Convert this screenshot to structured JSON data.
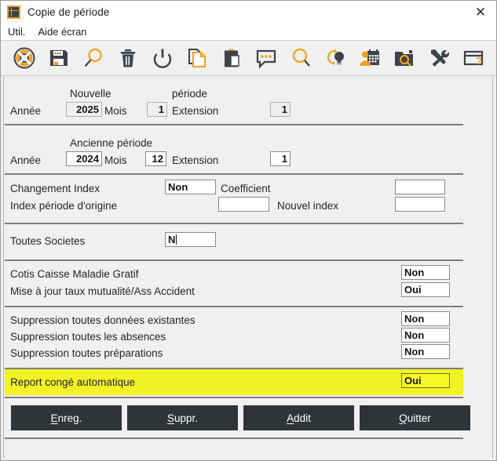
{
  "window": {
    "title": "Copie de période",
    "icon": "app-window-icon",
    "close_label": "✕"
  },
  "menubar": {
    "items": [
      {
        "label": "Util."
      },
      {
        "label": "Aide écran"
      }
    ]
  },
  "toolbar": {
    "buttons": [
      {
        "name": "lifebuoy-icon",
        "title": "Nouveau"
      },
      {
        "name": "save-floppy-icon",
        "title": "Enregistrer"
      },
      {
        "name": "magnifier-plus-icon",
        "title": "Rechercher"
      },
      {
        "name": "trash-icon",
        "title": "Supprimer"
      },
      {
        "name": "power-icon",
        "title": "Quitter"
      },
      {
        "name": "copy-page-icon",
        "title": "Copier"
      },
      {
        "name": "clipboard-paste-icon",
        "title": "Coller"
      },
      {
        "name": "comment-bubble-icon",
        "title": "Commentaire"
      },
      {
        "name": "search-icon",
        "title": "Recherche"
      },
      {
        "name": "refresh-bulb-icon",
        "title": "Astuce"
      },
      {
        "name": "person-calendar-icon",
        "title": "Planning"
      },
      {
        "name": "folder-search-icon",
        "title": "Consulter"
      },
      {
        "name": "tools-icon",
        "title": "Outils"
      },
      {
        "name": "window-help-icon",
        "title": "Aide"
      }
    ]
  },
  "form": {
    "new_period": {
      "header_left": "Nouvelle",
      "header_right": "période",
      "annee_label": "Année",
      "annee_value": "2025",
      "mois_label": "Mois",
      "mois_value": "1",
      "extension_label": "Extension",
      "extension_value": "1"
    },
    "old_period": {
      "header": "Ancienne période",
      "annee_label": "Année",
      "annee_value": "2024",
      "mois_label": "Mois",
      "mois_value": "12",
      "extension_label": "Extension",
      "extension_value": "1"
    },
    "index_group": {
      "changement_index_label": "Changement Index",
      "changement_index_value": "Non",
      "coefficient_label": "Coefficient",
      "coefficient_value": "",
      "index_origine_label": "Index période d'origine",
      "index_origine_value": "",
      "nouvel_index_label": "Nouvel index",
      "nouvel_index_value": ""
    },
    "societes_group": {
      "toutes_societes_label": "Toutes Societes",
      "toutes_societes_value": "N"
    },
    "cotis_group": {
      "rows": [
        {
          "label": "Cotis Caisse Maladie Gratif",
          "value": "Non"
        },
        {
          "label": "Mise à jour taux mutualité/Ass Accident",
          "value": "Oui"
        }
      ]
    },
    "suppression_group": {
      "rows": [
        {
          "label": "Suppression toutes données existantes",
          "value": "Non"
        },
        {
          "label": "Suppression toutes les absences",
          "value": "Non"
        },
        {
          "label": "Suppression toutes préparations",
          "value": "Non"
        }
      ]
    },
    "report_group": {
      "label": "Report congé automatique",
      "value": "Oui",
      "highlight_color": "#f2f226"
    }
  },
  "buttons": [
    {
      "name": "enreg-button",
      "prefix": "",
      "mnemonic": "E",
      "suffix": "nreg."
    },
    {
      "name": "suppr-button",
      "prefix": "",
      "mnemonic": "S",
      "suffix": "uppr."
    },
    {
      "name": "addit-button",
      "prefix": "",
      "mnemonic": "A",
      "suffix": "ddit"
    },
    {
      "name": "quitter-button",
      "prefix": "",
      "mnemonic": "Q",
      "suffix": "uitter"
    }
  ],
  "colors": {
    "accent": "#f0a020",
    "icon_dark": "#3d4348",
    "button_bg": "#2e3438",
    "highlight": "#f2f226"
  }
}
